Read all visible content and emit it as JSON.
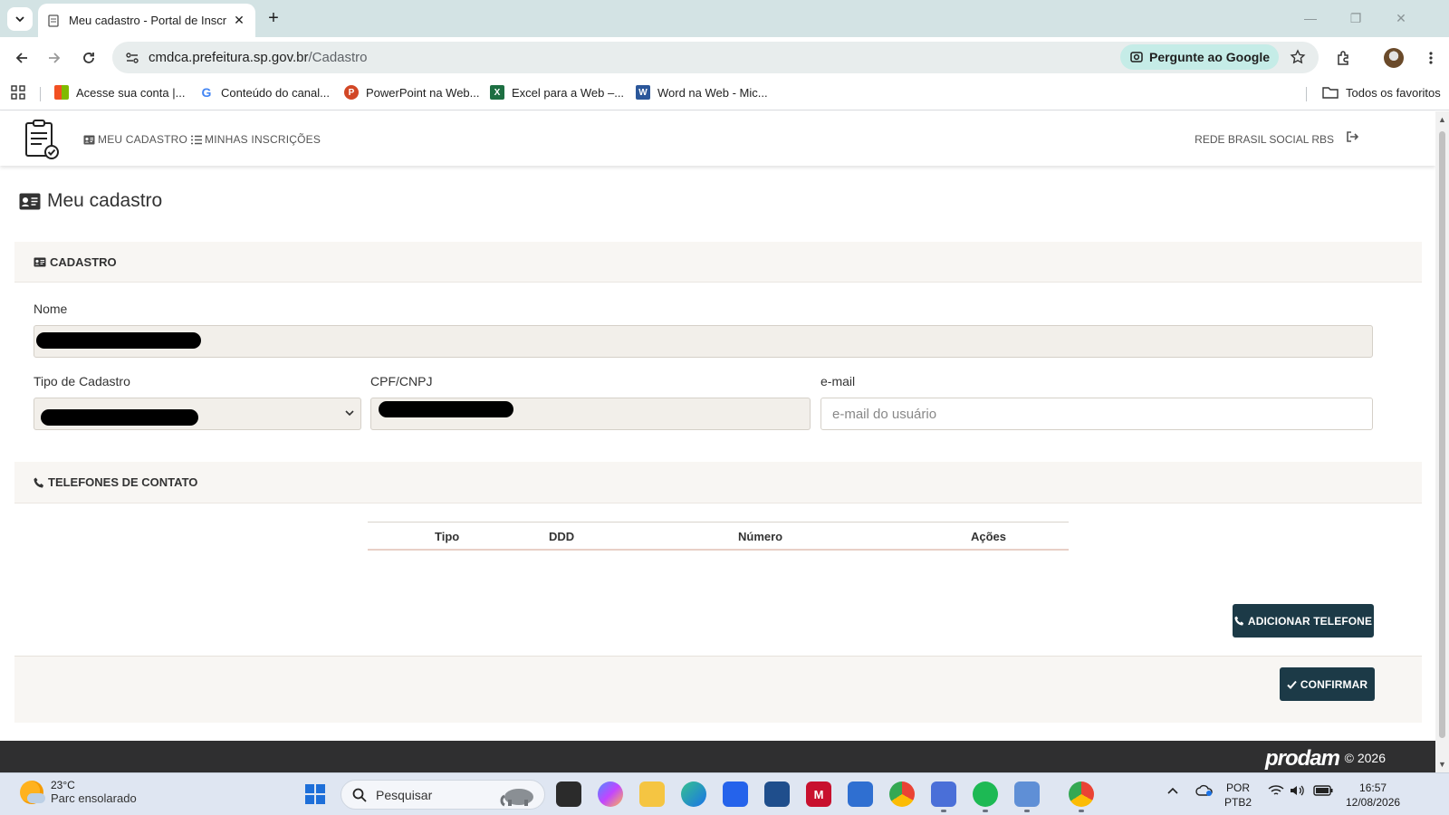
{
  "browser": {
    "tab": {
      "title": "Meu cadastro - Portal de Inscrição",
      "close": "✕"
    },
    "new_tab": "+",
    "window": {
      "minimize": "—",
      "restore": "❐",
      "close": "✕"
    },
    "url": {
      "host": "cmdca.prefeitura.sp.gov.br",
      "path": "/Cadastro"
    },
    "ask_google": "Pergunte ao Google",
    "bookmarks": [
      {
        "label": "Acesse sua conta |...",
        "icon": "microsoft-icon"
      },
      {
        "label": "Conteúdo do canal...",
        "icon": "google-icon"
      },
      {
        "label": "PowerPoint na Web...",
        "icon": "powerpoint-icon"
      },
      {
        "label": "Excel para a Web –...",
        "icon": "excel-icon"
      },
      {
        "label": "Word na Web - Mic...",
        "icon": "word-icon"
      }
    ],
    "all_bookmarks": "Todos os favoritos"
  },
  "navbar": {
    "links": [
      {
        "label": "MEU CADASTRO",
        "icon": "id-card-icon"
      },
      {
        "label": "MINHAS INSCRIÇÕES",
        "icon": "list-icon"
      }
    ],
    "org": "REDE BRASIL SOCIAL RBS",
    "logout_icon": "sign-out-icon"
  },
  "page": {
    "title": "Meu cadastro",
    "section_cadastro": "CADASTRO",
    "fields": {
      "nome_label": "Nome",
      "tipo_label": "Tipo de Cadastro",
      "cpf_label": "CPF/CNPJ",
      "email_label": "e-mail",
      "email_placeholder": "e-mail do usuário"
    },
    "section_telefones": "TELEFONES DE CONTATO",
    "phone_table": {
      "headers": [
        "Tipo",
        "DDD",
        "Número",
        "Ações"
      ],
      "rows": []
    },
    "add_phone_button": "ADICIONAR TELEFONE",
    "confirm_button": "CONFIRMAR"
  },
  "footer": {
    "brand": "prodam",
    "copyright": "© 2026"
  },
  "taskbar": {
    "weather": {
      "temp": "23°C",
      "desc": "Parc ensolarado"
    },
    "search_placeholder": "Pesquisar",
    "lang": {
      "line1": "POR",
      "line2": "PTB2"
    },
    "clock": {
      "time": "16:57",
      "date": "12/08/2026"
    }
  },
  "colors": {
    "accent_button": "#1c3a47",
    "card_header_bg": "#f8f6f3",
    "footer_bg": "#2f2f30"
  }
}
